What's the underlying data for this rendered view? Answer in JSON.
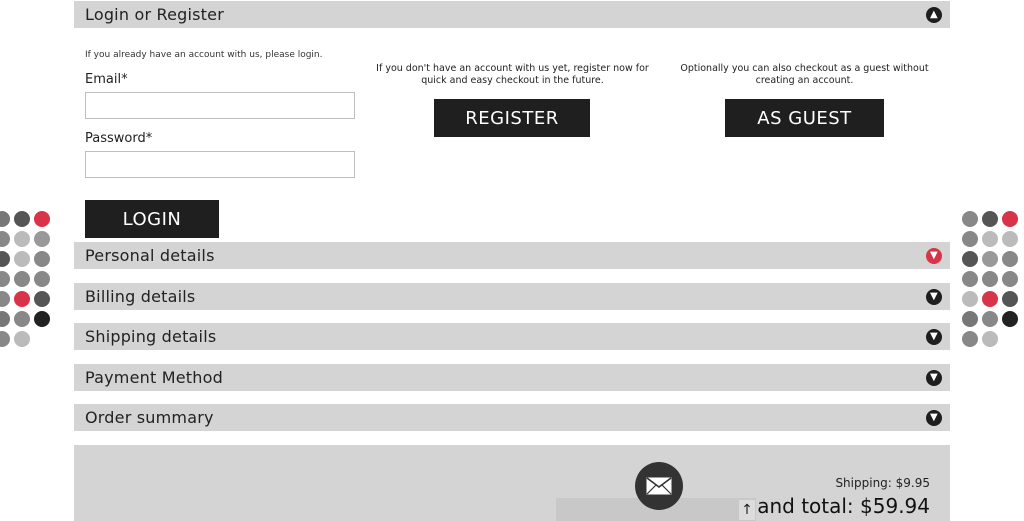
{
  "login_section": {
    "title": "Login or Register",
    "login_hint": "If you already have an account with us, please login.",
    "email_label": "Email*",
    "email_value": "",
    "password_label": "Password*",
    "password_value": "",
    "login_button": "LOGIN",
    "register_hint": "If you don't have an account with us yet, register now for quick and easy checkout in the future.",
    "register_button": "REGISTER",
    "guest_hint": "Optionally you can also checkout as a guest without creating an account.",
    "guest_button": "AS GUEST",
    "toggle_icon": "arrow-up-circle-icon"
  },
  "sections": [
    {
      "title": "Personal details",
      "toggle_icon": "arrow-down-circle-icon",
      "accent": "#d9334a"
    },
    {
      "title": "Billing details",
      "toggle_icon": "arrow-down-circle-icon",
      "accent": "#1e1e1e"
    },
    {
      "title": "Shipping details",
      "toggle_icon": "arrow-down-circle-icon",
      "accent": "#1e1e1e"
    },
    {
      "title": "Payment Method",
      "toggle_icon": "arrow-down-circle-icon",
      "accent": "#1e1e1e"
    },
    {
      "title": "Order summary",
      "toggle_icon": "arrow-down-circle-icon",
      "accent": "#1e1e1e"
    }
  ],
  "totals": {
    "shipping": "Shipping: $9.95",
    "grand_total": "and total: $59.94"
  },
  "widgets": {
    "mail_icon": "envelope-icon",
    "scroll_top_icon": "arrow-up-icon"
  },
  "colors": {
    "bar": "#d4d4d4",
    "button": "#1f1f1f",
    "accent_red": "#d9334a"
  },
  "dots_left": [
    "#777777",
    "#555555",
    "#d9334a",
    "#888888",
    "#bbbbbb",
    "#999999",
    "#555555",
    "#bbbbbb",
    "#888888",
    "#888888",
    "#888888",
    "#888888",
    "#888888",
    "#d9334a",
    "#555555",
    "#777777",
    "#888888",
    "#222222",
    "#888888",
    "#bbbbbb"
  ],
  "dots_right": [
    "#888888",
    "#555555",
    "#d9334a",
    "#888888",
    "#bbbbbb",
    "#bbbbbb",
    "#555555",
    "#999999",
    "#888888",
    "#888888",
    "#888888",
    "#888888",
    "#bbbbbb",
    "#d9334a",
    "#555555",
    "#777777",
    "#888888",
    "#222222",
    "#888888",
    "#bbbbbb"
  ]
}
